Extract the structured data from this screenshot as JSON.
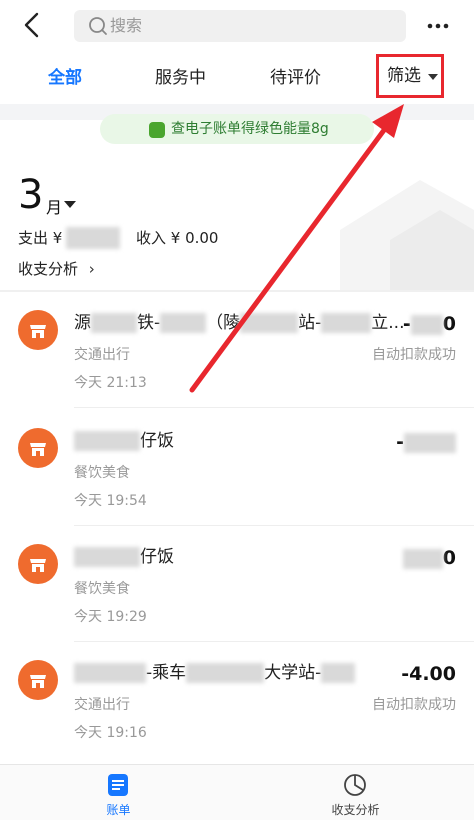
{
  "header": {
    "search_placeholder": "搜索"
  },
  "tabs": [
    {
      "label": "全部",
      "active": true
    },
    {
      "label": "服务中",
      "active": false
    },
    {
      "label": "待评价",
      "active": false
    }
  ],
  "filter": {
    "label": "筛选"
  },
  "banner": {
    "text": "查电子账单得绿色能量8g"
  },
  "summary": {
    "month": "3",
    "month_unit": "月",
    "expense_label": "支出 ¥",
    "income_label": "收入 ¥ 0.00",
    "analysis_label": "收支分析"
  },
  "records": [
    {
      "title_start": "源",
      "title_mid": "铁-",
      "title_tail": "（陵",
      "title_end": "站-",
      "title_suffix": "立...",
      "category": "交通出行",
      "time": "今天  21:13",
      "amount": "-",
      "amount_tail": "0",
      "status": "自动扣款成功"
    },
    {
      "title_start": "",
      "title_mid": "",
      "title_tail": "",
      "title_end": "仔饭",
      "title_suffix": "",
      "category": "餐饮美食",
      "time": "今天  19:54",
      "amount": "-",
      "amount_tail": "",
      "status": ""
    },
    {
      "title_start": "",
      "title_mid": "",
      "title_tail": "",
      "title_end": "仔饭",
      "title_suffix": "",
      "category": "餐饮美食",
      "time": "今天  19:29",
      "amount": "",
      "amount_tail": "0",
      "status": ""
    },
    {
      "title_start": "",
      "title_mid": "-乘车",
      "title_tail": "",
      "title_end": "大学站-",
      "title_suffix": "",
      "category": "交通出行",
      "time": "今天  19:16",
      "amount": "-4.00",
      "amount_tail": "",
      "status": "自动扣款成功"
    }
  ],
  "bottom_nav": [
    {
      "label": "账单",
      "active": true,
      "icon": "bill-icon"
    },
    {
      "label": "收支分析",
      "active": false,
      "icon": "chart-icon"
    }
  ],
  "colors": {
    "accent": "#1677ff",
    "highlight": "#e8272e",
    "record_icon": "#ef6b2e",
    "banner_bg": "#e9f7e7"
  }
}
